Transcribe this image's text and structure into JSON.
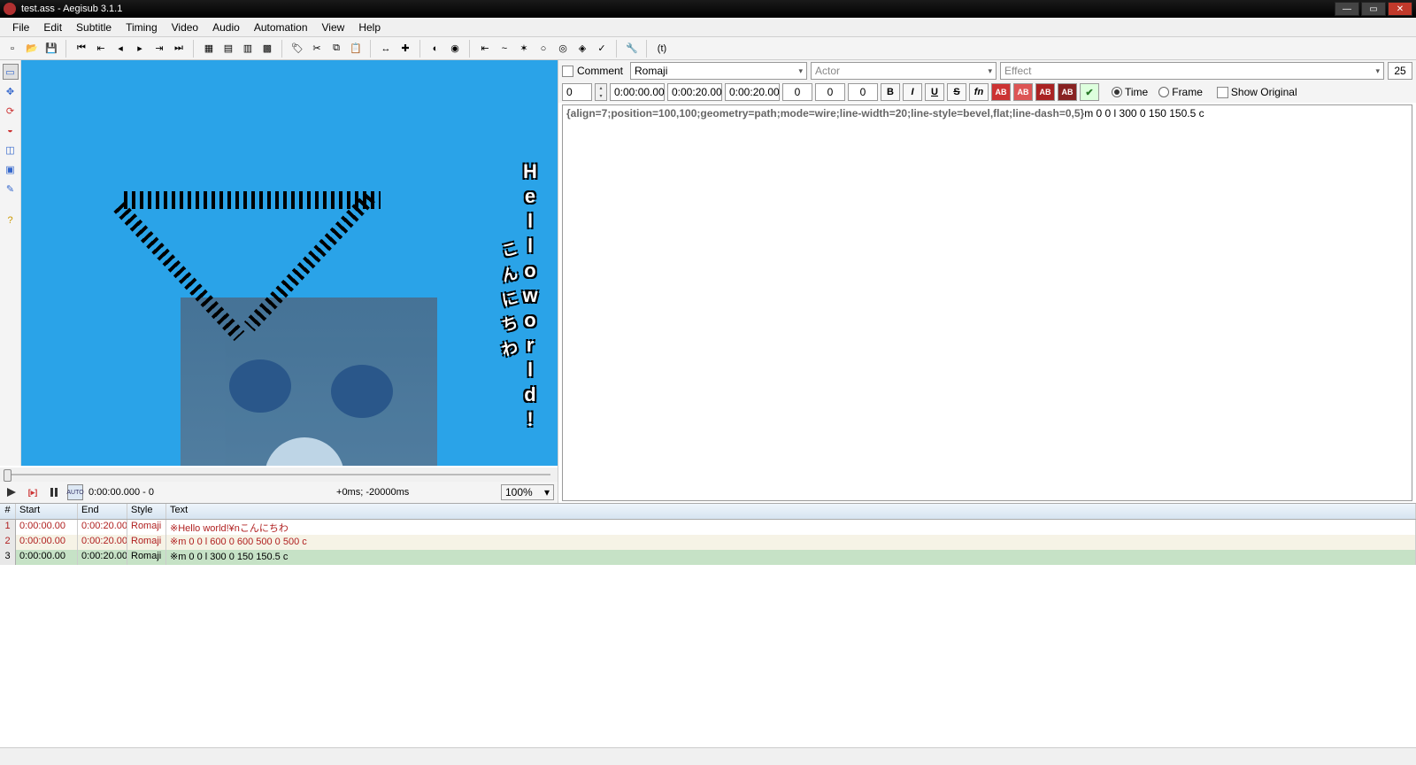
{
  "window": {
    "title": "test.ass - Aegisub 3.1.1"
  },
  "menu": {
    "items": [
      "File",
      "Edit",
      "Subtitle",
      "Timing",
      "Video",
      "Audio",
      "Automation",
      "View",
      "Help"
    ]
  },
  "toolbar_icons": [
    "new",
    "open",
    "save",
    "sep",
    "jump-start",
    "jump-keyframe-back",
    "step-back",
    "step-fwd",
    "jump-keyframe-fwd",
    "jump-end",
    "sep",
    "grid1",
    "grid2",
    "grid3",
    "grid4",
    "sep",
    "tag",
    "cut",
    "copy",
    "paste",
    "sep",
    "shift",
    "style-mgr",
    "sep",
    "assist1",
    "assist2",
    "sep",
    "auto1",
    "auto2",
    "auto3",
    "auto4",
    "auto5",
    "auto6",
    "auto7",
    "sep",
    "options",
    "sep",
    "irc"
  ],
  "vtools": [
    "pointer",
    "cross",
    "rotate-z",
    "rotate-xy",
    "scale",
    "clip-rect",
    "clip-vec",
    "help"
  ],
  "preview": {
    "hello": [
      "H",
      "e",
      "l",
      "l",
      "o",
      "w",
      "o",
      "r",
      "l",
      "d",
      "!"
    ],
    "jp": [
      "こ",
      "ん",
      "に",
      "ち",
      "わ"
    ]
  },
  "playback": {
    "timecode": "0:00:00.000 - 0",
    "offset": "+0ms; -20000ms",
    "zoom": "100%"
  },
  "edit": {
    "comment_label": "Comment",
    "style": "Romaji",
    "actor_placeholder": "Actor",
    "effect_placeholder": "Effect",
    "margin_r": "25",
    "layer": "0",
    "start": "0:00:00.00",
    "end": "0:00:20.00",
    "duration": "0:00:20.00",
    "mL": "0",
    "mR2": "0",
    "mV": "0",
    "time_label": "Time",
    "frame_label": "Frame",
    "show_orig_label": "Show Original",
    "text_prefix": "{align=7;position=100,100;geometry=path;mode=wire;line-width=20;line-style=bevel,flat;line-dash=0,5}",
    "text_body": "m 0 0 l 300 0 150 150.5 c"
  },
  "grid": {
    "cols": {
      "n": "#",
      "s": "Start",
      "e": "End",
      "st": "Style",
      "t": "Text"
    },
    "rows": [
      {
        "n": "1",
        "s": "0:00:00.00",
        "e": "0:00:20.00",
        "st": "Romaji",
        "t": "※Hello world!¥nこんにちわ",
        "red": true,
        "sel": false,
        "alt": false
      },
      {
        "n": "2",
        "s": "0:00:00.00",
        "e": "0:00:20.00",
        "st": "Romaji",
        "t": "※m 0 0 l 600 0 600 500 0 500 c",
        "red": true,
        "sel": false,
        "alt": true
      },
      {
        "n": "3",
        "s": "0:00:00.00",
        "e": "0:00:20.00",
        "st": "Romaji",
        "t": "※m 0 0 l 300 0 150 150.5 c",
        "red": false,
        "sel": true,
        "alt": false
      }
    ]
  }
}
